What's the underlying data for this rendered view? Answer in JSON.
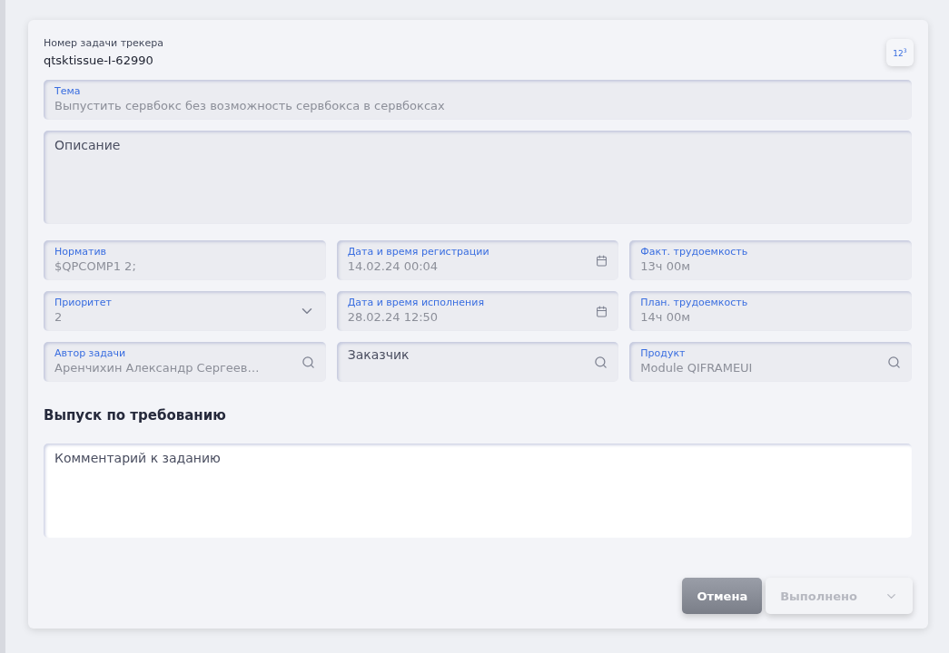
{
  "header": {
    "label": "Номер задачи трекера",
    "value": "qtsktissue-I-62990",
    "badge": "12$^{3}$"
  },
  "subject": {
    "label": "Тема",
    "value": "Выпустить сервбокс без возможность сервбокса в сервбоксах"
  },
  "description": {
    "placeholder": "Описание"
  },
  "fields": [
    {
      "kind": "text",
      "label": "Норматив",
      "value": "$QPCOMP1 2;"
    },
    {
      "kind": "date",
      "label": "Дата и время регистрации",
      "value": "14.02.24 00:04"
    },
    {
      "kind": "text",
      "label": "Факт. трудоемкость",
      "value": "13ч 00м"
    },
    {
      "kind": "select",
      "label": "Приоритет",
      "value": "2"
    },
    {
      "kind": "date",
      "label": "Дата и время исполнения",
      "value": "28.02.24 12:50"
    },
    {
      "kind": "text",
      "label": "План. трудоемкость",
      "value": "14ч 00м"
    },
    {
      "kind": "lookup",
      "label": "Автор задачи",
      "value": "Аренчихин Александр Сергеев…"
    },
    {
      "kind": "lookup",
      "placeholder": "Заказчик"
    },
    {
      "kind": "lookup",
      "label": "Продукт",
      "value": "Module QIFRAMEUI"
    }
  ],
  "section_title": "Выпуск по требованию",
  "comment": {
    "placeholder": "Комментарий к заданию"
  },
  "buttons": [
    {
      "kind": "primary",
      "label": "Отмена",
      "disabled": false
    },
    {
      "kind": "split",
      "label": "Выполнено",
      "disabled": true
    }
  ]
}
